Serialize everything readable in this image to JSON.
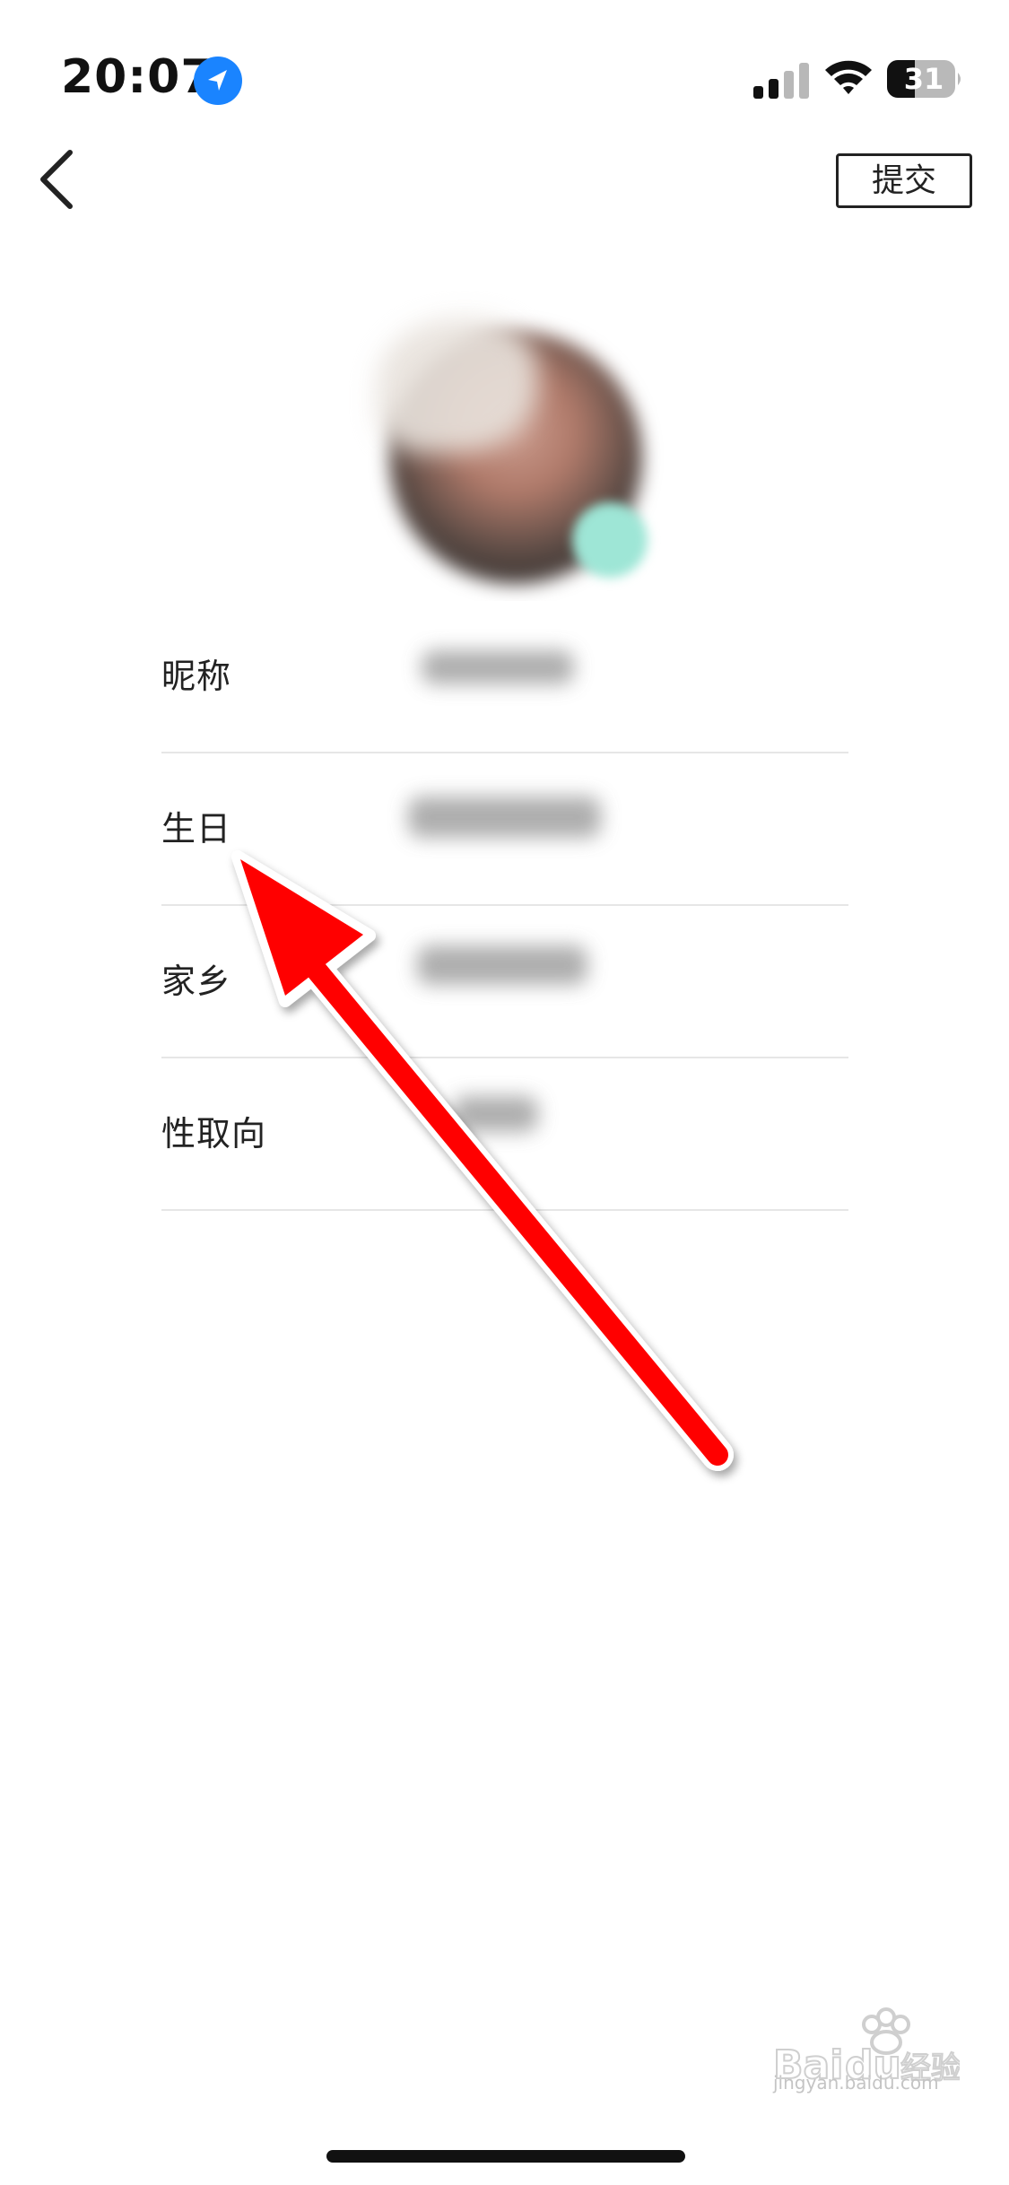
{
  "status_bar": {
    "time": "20:07",
    "battery_level": "31",
    "location_icon": "location-arrow-icon",
    "signal_icon": "cellular-signal-icon",
    "wifi_icon": "wifi-icon",
    "battery_icon": "battery-icon"
  },
  "nav": {
    "back_icon": "chevron-left-icon",
    "submit_label": "提交"
  },
  "form": {
    "rows": [
      {
        "label": "昵称",
        "value": ""
      },
      {
        "label": "生日",
        "value": ""
      },
      {
        "label": "家乡",
        "value": ""
      },
      {
        "label": "性取向",
        "value": ""
      }
    ]
  },
  "annotation": {
    "arrow_color": "#ff0000"
  },
  "watermark": {
    "logo": "Baidu 经验",
    "url": "jingyan.baidu.com"
  },
  "colors": {
    "accent": "#1a84ff",
    "divider": "#e6e6e6"
  }
}
